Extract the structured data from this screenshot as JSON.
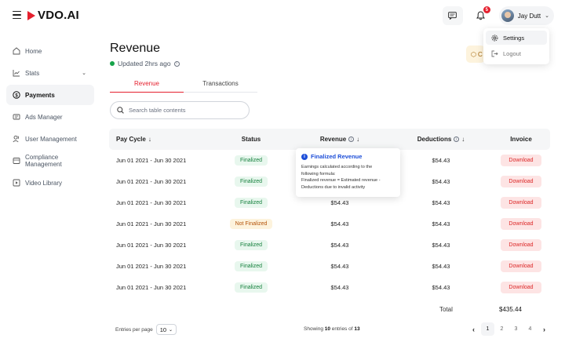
{
  "brand": {
    "name": "VDO.AI",
    "accent": "#e5202e"
  },
  "header": {
    "notifications_count": "5",
    "user_name": "Jay Dutt",
    "dropdown": {
      "settings": "Settings",
      "logout": "Logout"
    }
  },
  "sidebar": {
    "items": [
      {
        "label": "Home",
        "icon": "home-icon"
      },
      {
        "label": "Stats",
        "icon": "chart-icon"
      },
      {
        "label": "Payments",
        "icon": "dollar-icon"
      },
      {
        "label": "Ads Manager",
        "icon": "ads-icon"
      },
      {
        "label": "User Management",
        "icon": "users-icon"
      },
      {
        "label": "Compliance Management",
        "icon": "compliance-icon"
      },
      {
        "label": "Video Library",
        "icon": "video-icon"
      }
    ],
    "active": "Payments"
  },
  "page": {
    "title": "Revenue",
    "updated": "Updated 2hrs ago",
    "partial_button": "C"
  },
  "tabs": {
    "revenue": "Revenue",
    "transactions": "Transactions"
  },
  "search": {
    "placeholder": "Search table contents",
    "value": ""
  },
  "table": {
    "headers": {
      "pay_cycle": "Pay Cycle",
      "status": "Status",
      "revenue": "Revenue",
      "deductions": "Deductions",
      "invoice": "Invoice"
    },
    "rows": [
      {
        "pay_cycle": "Jun 01 2021 - Jun 30 2021",
        "status": "Finalized",
        "revenue": "",
        "deductions": "$54.43",
        "invoice": "Download"
      },
      {
        "pay_cycle": "Jun 01 2021 - Jun 30 2021",
        "status": "Finalized",
        "revenue": "",
        "deductions": "$54.43",
        "invoice": "Download"
      },
      {
        "pay_cycle": "Jun 01 2021 - Jun 30 2021",
        "status": "Finalized",
        "revenue": "$54.43",
        "deductions": "$54.43",
        "invoice": "Download"
      },
      {
        "pay_cycle": "Jun 01 2021 - Jun 30 2021",
        "status": "Not Finalized",
        "revenue": "$54.43",
        "deductions": "$54.43",
        "invoice": "Download"
      },
      {
        "pay_cycle": "Jun 01 2021 - Jun 30 2021",
        "status": "Finalized",
        "revenue": "$54.43",
        "deductions": "$54.43",
        "invoice": "Download"
      },
      {
        "pay_cycle": "Jun 01 2021 - Jun 30 2021",
        "status": "Finalized",
        "revenue": "$54.43",
        "deductions": "$54.43",
        "invoice": "Download"
      },
      {
        "pay_cycle": "Jun 01 2021 - Jun 30 2021",
        "status": "Finalized",
        "revenue": "$54.43",
        "deductions": "$54.43",
        "invoice": "Download"
      }
    ],
    "total_label": "Total",
    "total_value": "$435.44"
  },
  "tooltip": {
    "title": "Finalized Revenue",
    "lines": [
      "Earnings calculated according to the",
      "following formula:",
      "Finalized revenue = Estimated revenue -",
      "Deductions due to invalid activity"
    ]
  },
  "footer": {
    "entries_label": "Entries per page",
    "entries_value": "10",
    "showing_prefix": "Showing",
    "showing_count": "10",
    "showing_mid": "entries of",
    "showing_total": "13",
    "pages": [
      "1",
      "2",
      "3",
      "4"
    ],
    "current_page": "1"
  }
}
